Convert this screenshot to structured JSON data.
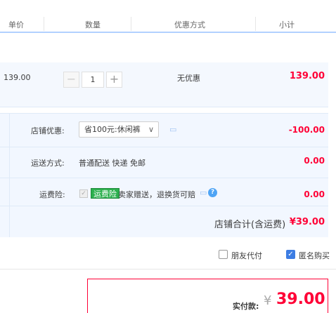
{
  "header": {
    "col_price": "单价",
    "col_qty": "数量",
    "col_promo": "优惠方式",
    "col_subtotal": "小计"
  },
  "item": {
    "price": "139.00",
    "quantity": "1",
    "minus": "−",
    "plus": "+",
    "promo": "无优惠",
    "subtotal": "139.00"
  },
  "shop": {
    "discount_label": "店铺优惠:",
    "discount_select": "省100元:休闲裤",
    "discount_value": "-100.00",
    "shipping_label": "运送方式:",
    "shipping_value": "普通配送 快递 免邮",
    "shipping_cost": "0.00",
    "insurance_label": "运费险:",
    "insurance_tag": "运费险",
    "insurance_desc": "卖家赠送，退换货可赔",
    "insurance_cost": "0.00",
    "total_label": "店铺合计(含运费)",
    "total_value": "¥39.00"
  },
  "options": {
    "friend_pay": "朋友代付",
    "anonymous": "匿名购买"
  },
  "payment": {
    "label": "实付款:",
    "currency": "¥",
    "amount": "39.00"
  },
  "colors": {
    "accent_red": "#ff0036",
    "checkbox_blue": "#3d7de3",
    "insure_green": "#2db04e"
  }
}
